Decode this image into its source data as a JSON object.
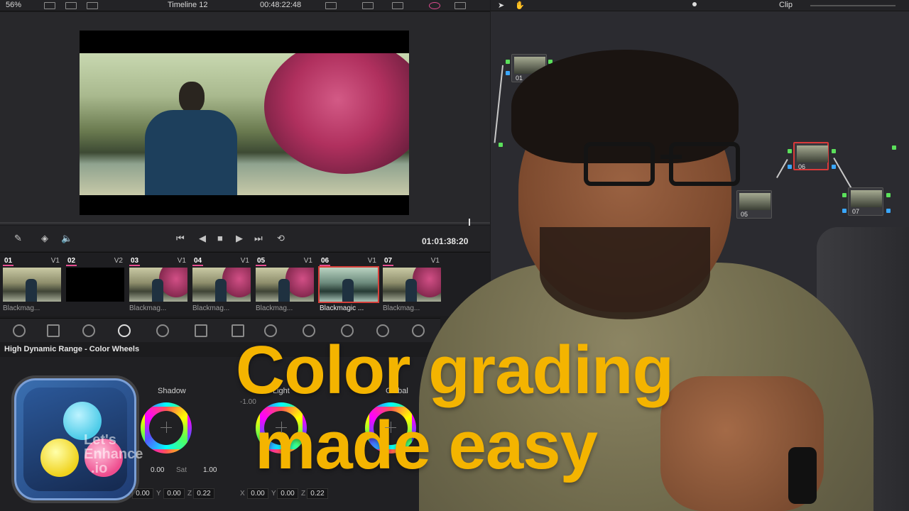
{
  "toolbar": {
    "zoom": "56%",
    "timeline": "Timeline 12",
    "timecode": "00:48:22:48"
  },
  "transport": {
    "timecode": "01:01:38:20"
  },
  "clips": [
    {
      "num": "01",
      "track": "V1",
      "label": "Blackmag..."
    },
    {
      "num": "02",
      "track": "V2",
      "label": ""
    },
    {
      "num": "03",
      "track": "V1",
      "label": "Blackmag..."
    },
    {
      "num": "04",
      "track": "V1",
      "label": "Blackmag..."
    },
    {
      "num": "05",
      "track": "V1",
      "label": "Blackmag..."
    },
    {
      "num": "06",
      "track": "V1",
      "label": "Blackmagic ..."
    },
    {
      "num": "07",
      "track": "V1",
      "label": "Blackmag..."
    }
  ],
  "panel": {
    "title": "High Dynamic Range - Color Wheels"
  },
  "wheels": {
    "shadow_label": "Shadow",
    "light_label": "Light",
    "global_label": "Global",
    "top_value": "-1.00",
    "sat_label": "Sat",
    "sat_value_left": "0.00",
    "sat_value_right": "1.00",
    "x_label": "X",
    "y_label": "Y",
    "z_label": "Z",
    "values_row1": [
      "0.00",
      "0.00",
      "0.22"
    ],
    "values_row2": [
      "0.00",
      "0.00",
      "0.22"
    ]
  },
  "nodegraph": {
    "clip_label": "Clip",
    "nodes": [
      {
        "id": "01"
      },
      {
        "id": "05"
      },
      {
        "id": "06"
      },
      {
        "id": "07"
      }
    ]
  },
  "headline": {
    "line1": "Color grading",
    "line2": "made easy"
  },
  "brand": {
    "line1": "Let's",
    "line2": "Enhance",
    "line3": ".io"
  },
  "colors": {
    "headline": "#f4b400",
    "active_clip_border": "#d6403a",
    "clip_number_underline": "#e64d8f"
  }
}
